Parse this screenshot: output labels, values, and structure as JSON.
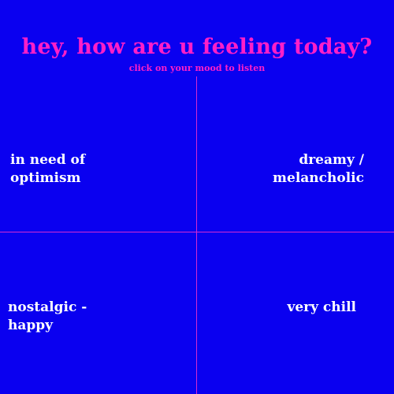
{
  "header": {
    "title": "hey, how are u feeling today?",
    "subtitle": "click on your mood to listen"
  },
  "moods": [
    {
      "line1": "in need of",
      "line2": "optimism"
    },
    {
      "line1": "dreamy /",
      "line2": "melancholic"
    },
    {
      "line1": "nostalgic -",
      "line2": "happy"
    },
    {
      "line1": "very chill",
      "line2": ""
    }
  ],
  "colors": {
    "background": "#0a00f0",
    "accent": "#ff1fc8",
    "divider": "#d52ad0",
    "mood_text": "#ffffff"
  }
}
